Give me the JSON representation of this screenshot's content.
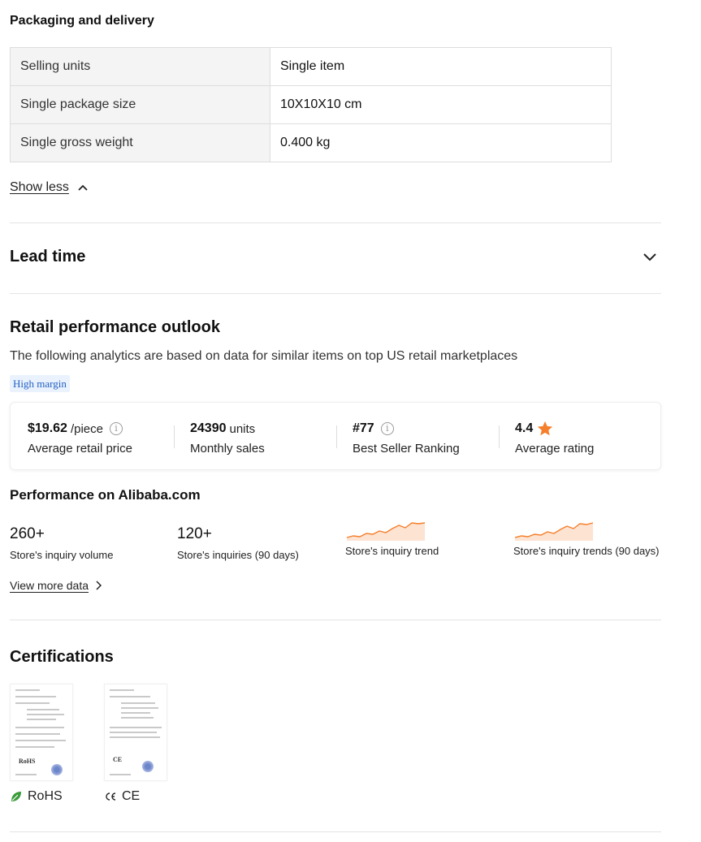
{
  "packaging": {
    "title": "Packaging and delivery",
    "rows": [
      {
        "key": "Selling units",
        "value": "Single item"
      },
      {
        "key": "Single package size",
        "value": "10X10X10 cm"
      },
      {
        "key": "Single gross weight",
        "value": "0.400 kg"
      }
    ],
    "show_less_label": "Show less"
  },
  "lead_time": {
    "title": "Lead time"
  },
  "retail": {
    "title": "Retail performance outlook",
    "subtitle": "The following analytics are based on data for similar items on top US retail marketplaces",
    "badge": "High margin",
    "stats": [
      {
        "value": "$19.62",
        "unit": "/piece",
        "label": "Average retail price"
      },
      {
        "value": "24390",
        "unit": "units",
        "label": "Monthly sales"
      },
      {
        "value": "#77",
        "unit": "",
        "label": "Best Seller Ranking"
      },
      {
        "value": "4.4",
        "unit": "",
        "label": "Average rating"
      }
    ],
    "accent_color": "#f57f2b"
  },
  "alibaba_performance": {
    "title": "Performance on Alibaba.com",
    "metrics": [
      {
        "value": "260+",
        "label": "Store's inquiry volume"
      },
      {
        "value": "120+",
        "label": "Store's inquiries (90 days)"
      },
      {
        "label": "Store's inquiry trend"
      },
      {
        "label": "Store's inquiry trends (90 days)"
      }
    ],
    "view_more_label": "View more data"
  },
  "certifications": {
    "title": "Certifications",
    "items": [
      {
        "name": "RoHS",
        "icon": "leaf-icon",
        "doc_mark": "RoHS"
      },
      {
        "name": "CE",
        "icon": "ce-mark-icon",
        "doc_mark": "CE"
      }
    ]
  }
}
